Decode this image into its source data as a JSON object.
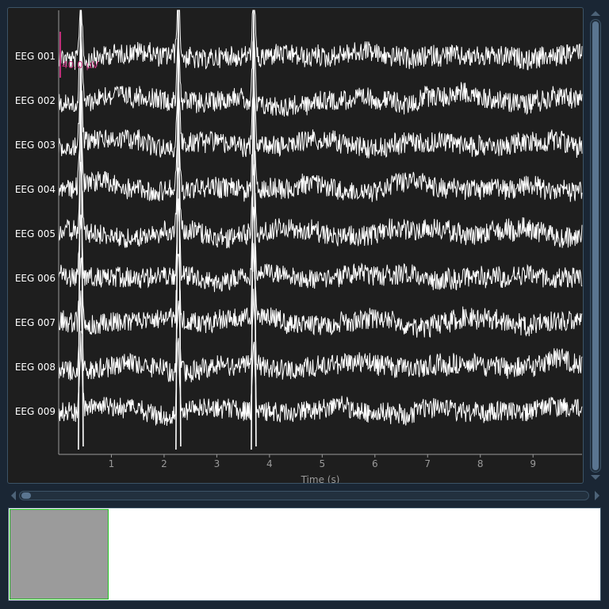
{
  "plot": {
    "channels": [
      "EEG 001",
      "EEG 002",
      "EEG 003",
      "EEG 004",
      "EEG 005",
      "EEG 006",
      "EEG 007",
      "EEG 008",
      "EEG 009"
    ],
    "x_ticks": [
      "1",
      "2",
      "3",
      "4",
      "5",
      "6",
      "7",
      "8",
      "9"
    ],
    "xlabel": "Time (s)",
    "scale_label": "40.0 µV",
    "x_range": [
      0,
      9.93
    ],
    "colors": {
      "background": "#1e1e1e",
      "trace": "#ffffff",
      "axis": "#9a9a9a",
      "scale_bar": "#c0307a",
      "label": "#ffffff"
    }
  },
  "overview": {
    "window_start_fraction": 0.0,
    "window_end_fraction": 0.167,
    "colors": {
      "window": "#9b9b9b",
      "window_border": "#22c422"
    }
  }
}
